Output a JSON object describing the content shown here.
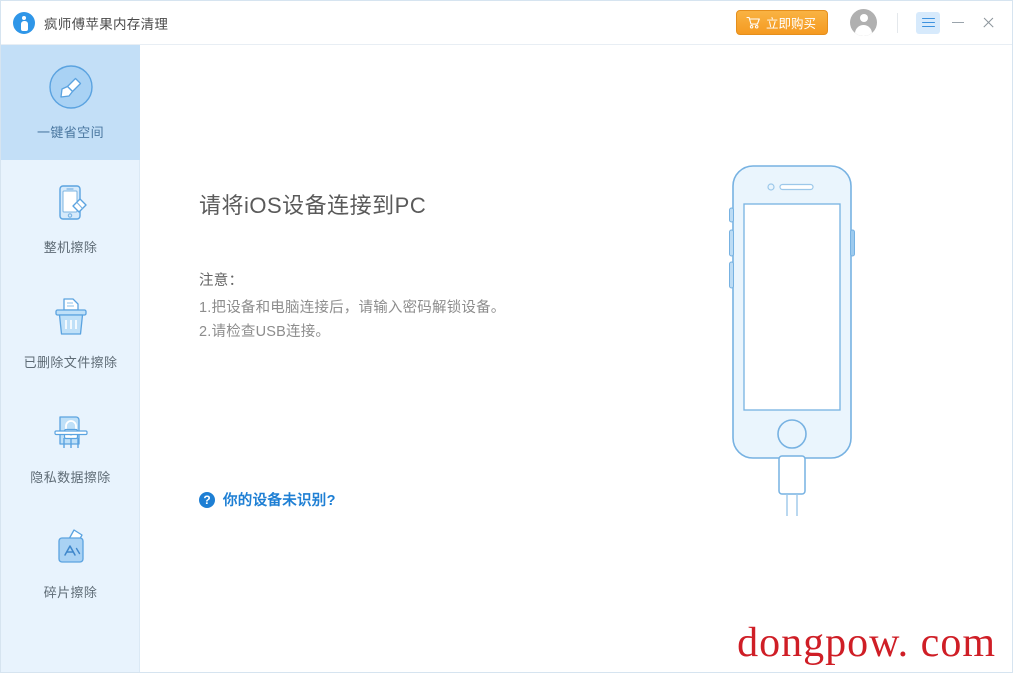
{
  "window": {
    "title": "疯师傅苹果内存清理",
    "logo_icon": "app-logo-icon"
  },
  "titlebar": {
    "buy_button_label": "立即购买",
    "buy_button_icon": "cart-icon",
    "buy_button_color": "#f59a21",
    "avatar_icon": "user-avatar-icon",
    "menu_icon": "hamburger-menu-icon",
    "minimize_icon": "minimize-icon",
    "close_icon": "close-icon"
  },
  "sidebar": {
    "background_color": "#e8f3fd",
    "active_color": "#c3dff7",
    "items": [
      {
        "label": "一键省空间",
        "icon": "broom-circle-icon",
        "active": true
      },
      {
        "label": "整机擦除",
        "icon": "phone-eraser-icon",
        "active": false
      },
      {
        "label": "已删除文件擦除",
        "icon": "shredder-trash-icon",
        "active": false
      },
      {
        "label": "隐私数据擦除",
        "icon": "lock-shred-icon",
        "active": false
      },
      {
        "label": "碎片擦除",
        "icon": "app-fragment-icon",
        "active": false
      }
    ]
  },
  "main": {
    "headline": "请将iOS设备连接到PC",
    "note_title": "注意：",
    "note_line_1": "1.把设备和电脑连接后，请输入密码解锁设备。",
    "note_line_2": "2.请检查USB连接。",
    "help_icon": "question-mark-icon",
    "help_link": "你的设备未识别?",
    "help_link_color": "#1e7fd4",
    "illustration": "iphone-with-lightning-cable-icon",
    "illustration_color": "#7cb4e2"
  },
  "watermark": {
    "text": "dongpow. com",
    "color": "#cf1e26"
  }
}
